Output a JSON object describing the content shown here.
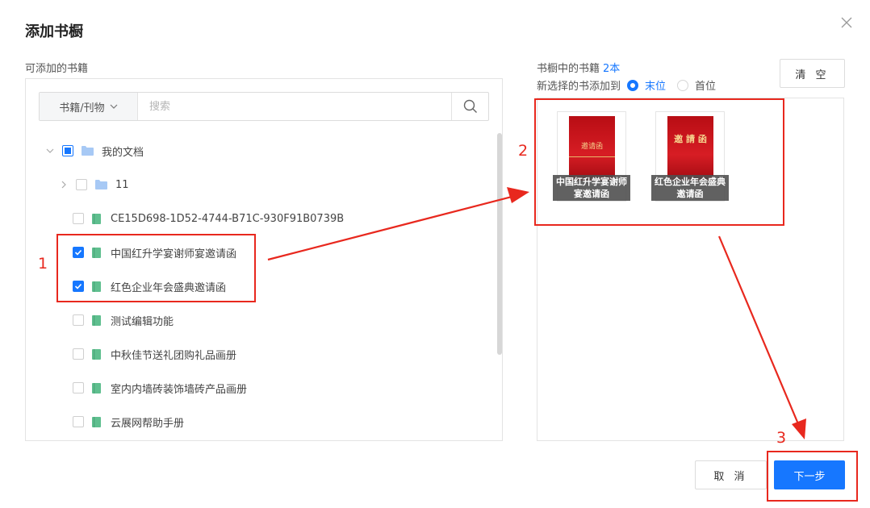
{
  "dialog": {
    "title": "添加书橱",
    "close_icon": "close-icon"
  },
  "left": {
    "label": "可添加的书籍",
    "search": {
      "type_label": "书籍/刊物",
      "placeholder": "搜索"
    },
    "tree": [
      {
        "label": "我的文档",
        "kind": "folder",
        "expanded": true,
        "state": "partial"
      },
      {
        "label": "11",
        "kind": "folder",
        "expanded": false,
        "state": "unchecked"
      },
      {
        "label": "CE15D698-1D52-4744-B71C-930F91B0739B",
        "kind": "book",
        "state": "unchecked"
      },
      {
        "label": "中国红升学宴谢师宴邀请函",
        "kind": "book",
        "state": "checked"
      },
      {
        "label": "红色企业年会盛典邀请函",
        "kind": "book",
        "state": "checked"
      },
      {
        "label": "测试编辑功能",
        "kind": "book",
        "state": "unchecked"
      },
      {
        "label": "中秋佳节送礼团购礼品画册",
        "kind": "book",
        "state": "unchecked"
      },
      {
        "label": "室内内墙砖装饰墙砖产品画册",
        "kind": "book",
        "state": "unchecked"
      },
      {
        "label": "云展网帮助手册",
        "kind": "book",
        "state": "unchecked"
      }
    ]
  },
  "right": {
    "label": "书橱中的书籍",
    "count": "2本",
    "position_label": "新选择的书添加到",
    "position_options": [
      "末位",
      "首位"
    ],
    "selected_position": "末位",
    "clear_label": "清 空",
    "books": [
      {
        "title": "中国红升学宴谢师宴邀请函",
        "cover_text": "邀请函"
      },
      {
        "title": "红色企业年会盛典邀请函",
        "cover_text": "邀 請 函"
      }
    ]
  },
  "footer": {
    "cancel_label": "取 消",
    "next_label": "下一步"
  },
  "annotations": {
    "step1": "1",
    "step2": "2",
    "step3": "3",
    "color": "#e8281e"
  },
  "colors": {
    "accent": "#1677ff",
    "cover_red": "#c8141b",
    "annotation": "#e8281e"
  }
}
